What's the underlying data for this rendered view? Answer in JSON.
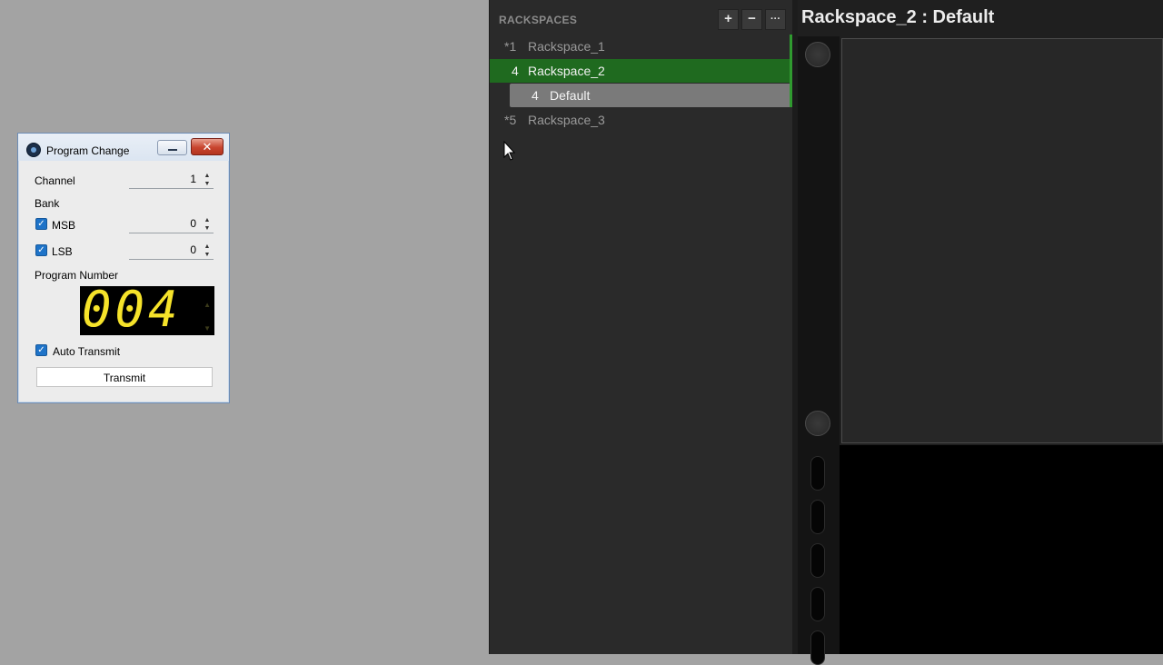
{
  "dialog": {
    "title": "Program Change",
    "close_glyph": "✕",
    "channel_label": "Channel",
    "channel_value": "1",
    "bank_label": "Bank",
    "msb_label": "MSB",
    "msb_value": "0",
    "msb_checked": true,
    "lsb_label": "LSB",
    "lsb_value": "0",
    "lsb_checked": true,
    "program_number_label": "Program Number",
    "program_display": "004",
    "auto_transmit_label": "Auto Transmit",
    "auto_transmit_checked": true,
    "transmit_label": "Transmit"
  },
  "rackspaces": {
    "header": "RACKSPACES",
    "buttons": {
      "add": "+",
      "remove": "−",
      "more": "···"
    },
    "items": [
      {
        "num": "*1",
        "name": "Rackspace_1"
      },
      {
        "num": "4",
        "name": "Rackspace_2",
        "active": true
      },
      {
        "num": "4",
        "name": "Default",
        "variation": true
      },
      {
        "num": "*5",
        "name": "Rackspace_3"
      }
    ]
  },
  "main": {
    "title": "Rackspace_2 : Default"
  },
  "colors": {
    "active_row": "#1f6a1f",
    "variation_row": "#7a7a7a",
    "lcd_digits": "#f6e32a",
    "checkbox": "#1e73c8"
  }
}
